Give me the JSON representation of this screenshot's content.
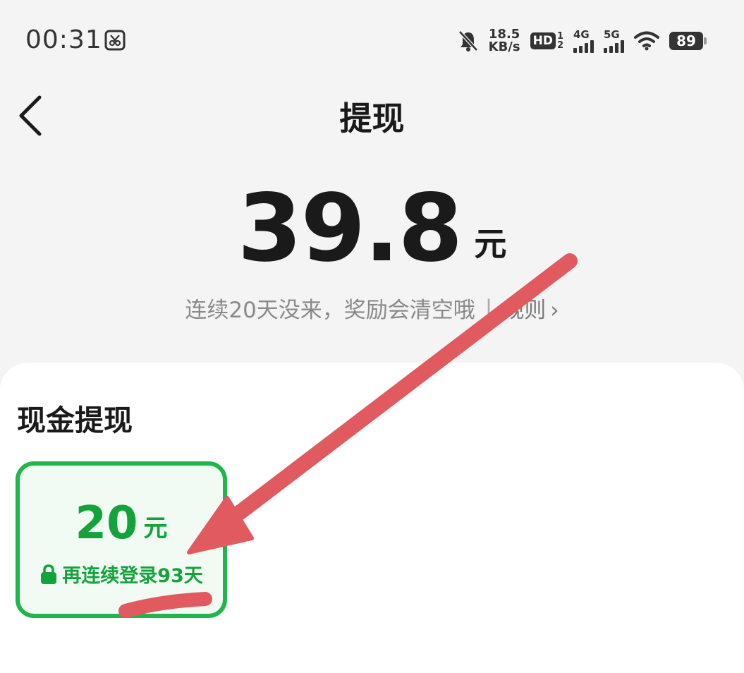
{
  "status_bar": {
    "time": "00:31",
    "net_speed_value": "18.5",
    "net_speed_unit": "KB/s",
    "hd_label": "HD",
    "hd_sub_top": "1",
    "hd_sub_bottom": "2",
    "signal1_label": "4G",
    "signal2_label": "5G",
    "battery": "89",
    "icons": [
      "screenshot-icon",
      "bell-muted-icon",
      "wifi-icon",
      "battery-icon"
    ]
  },
  "header": {
    "title": "提现",
    "back_icon": "chevron-left-icon"
  },
  "balance": {
    "amount": "39.8",
    "unit": "元",
    "notice": "连续20天没来，奖励会清空哦",
    "divider": "|",
    "rules_label": "规则",
    "rules_chevron": "›"
  },
  "withdraw": {
    "section_title": "现金提现",
    "options": [
      {
        "amount": "20",
        "unit": "元",
        "condition": "再连续登录93天",
        "selected": true,
        "locked": true
      }
    ]
  },
  "colors": {
    "accent_green": "#1fb64a",
    "text_green": "#14a33b",
    "annotation_red": "#e05a5f"
  }
}
